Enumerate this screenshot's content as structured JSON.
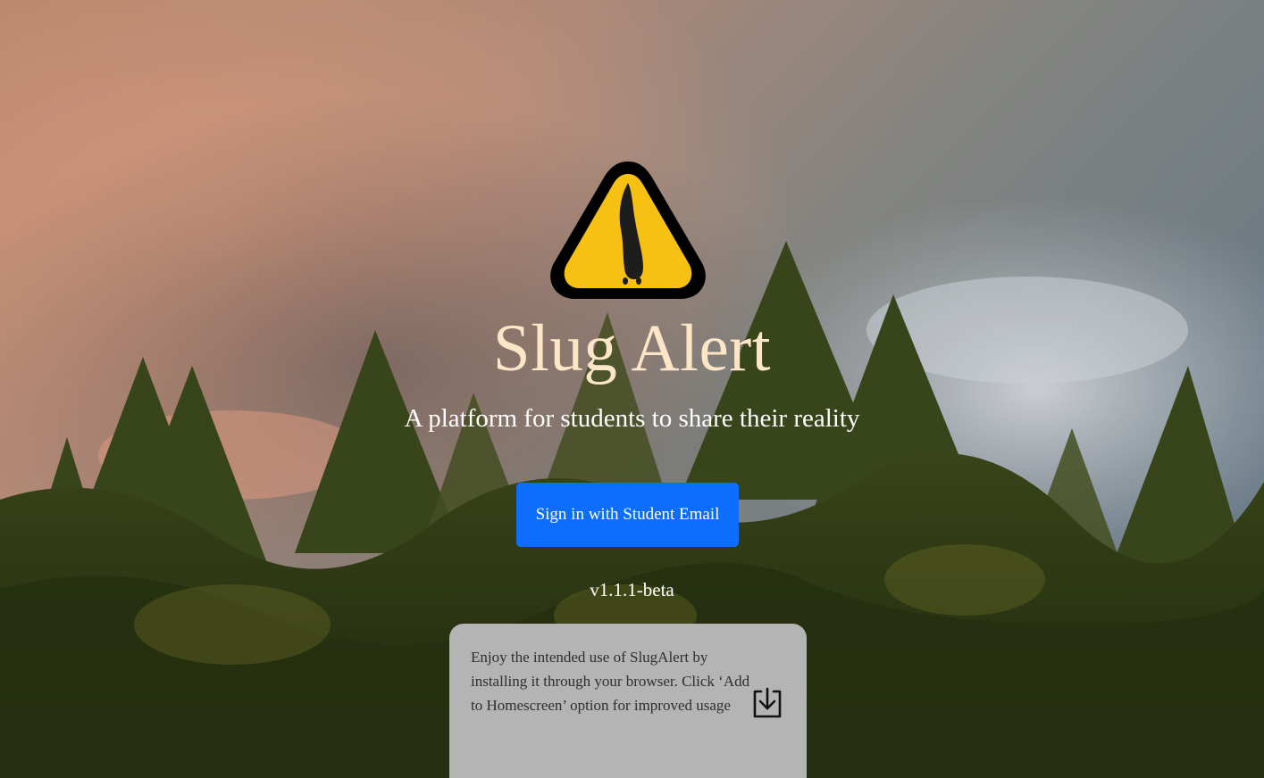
{
  "app": {
    "title": "Slug Alert",
    "tagline": "A platform for students to share their reality",
    "version": "v1.1.1-beta"
  },
  "auth": {
    "signin_label": "Sign in with Student Email"
  },
  "install_prompt": {
    "text": "Enjoy the intended use of SlugAlert by installing it through your browser. Click ‘Add to Homescreen’ option for improved usage",
    "icon": "download-icon"
  },
  "colors": {
    "title": "#fde5c8",
    "button": "#0d6efd",
    "card": "#b4b4b4",
    "logo_yellow": "#f7c114",
    "logo_border": "#000000"
  },
  "icons": {
    "logo": "slug-warning-sign-icon"
  }
}
